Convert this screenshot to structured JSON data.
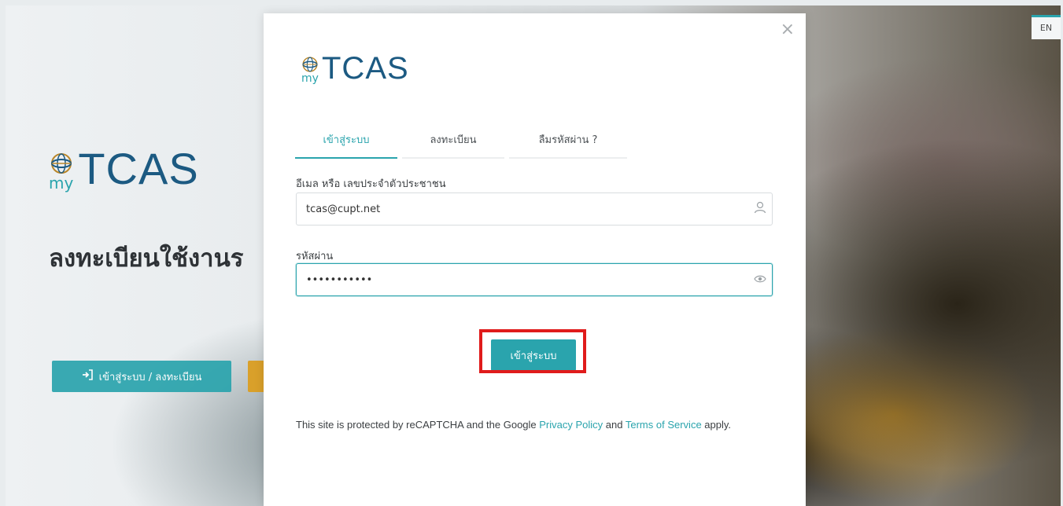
{
  "language_toggle": "EN",
  "background": {
    "logo_my": "my",
    "logo_text": "TCAS",
    "heading": "ลงทะเบียนใช้งานร",
    "login_button_label": "เข้าสู่ระบบ / ลงทะเบียน"
  },
  "modal": {
    "close_symbol": "×",
    "logo_my": "my",
    "logo_text": "TCAS",
    "tabs": [
      {
        "label": "เข้าสู่ระบบ",
        "active": true
      },
      {
        "label": "ลงทะเบียน",
        "active": false
      },
      {
        "label": "ลืมรหัสผ่าน ?",
        "active": false
      }
    ],
    "email_label": "อีเมล หรือ เลขประจำตัวประชาชน",
    "email_value": "tcas@cupt.net",
    "password_label": "รหัสผ่าน",
    "password_value": "•••••••••••",
    "submit_label": "เข้าสู่ระบบ",
    "recaptcha": {
      "prefix": "This site is protected by reCAPTCHA and the Google ",
      "privacy_link": "Privacy Policy",
      "middle": " and ",
      "terms_link": "Terms of Service",
      "suffix": " apply."
    }
  },
  "colors": {
    "accent": "#2aa4ad",
    "brand_navy": "#1c5a82",
    "highlight_red": "#e01b1b",
    "orange": "#d9a02a"
  },
  "icons": [
    "globe-logo-icon",
    "sign-in-icon",
    "close-icon",
    "user-icon",
    "eye-icon"
  ]
}
